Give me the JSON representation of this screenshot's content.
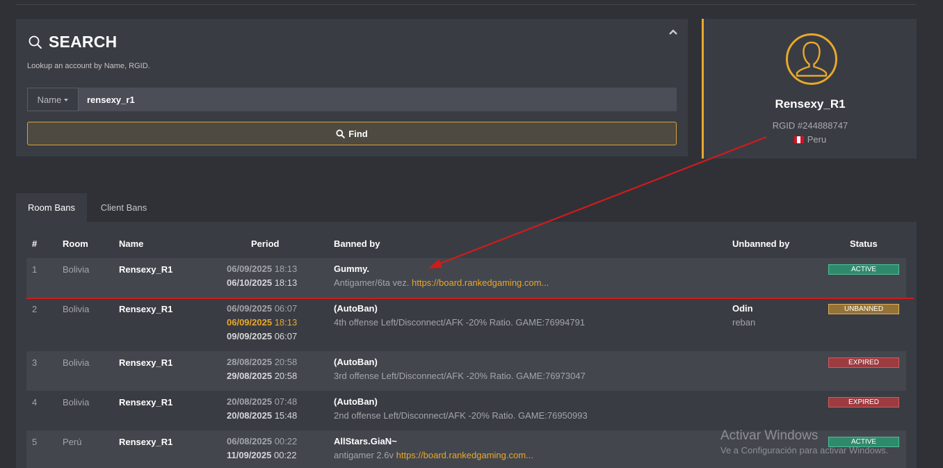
{
  "search": {
    "title": "SEARCH",
    "subtitle": "Lookup an account by Name, RGID.",
    "select_value": "Name",
    "input_value": "rensexy_r1",
    "find_label": "Find"
  },
  "profile": {
    "name": "Rensexy_R1",
    "rgid": "RGID #244888747",
    "country": "Peru"
  },
  "tabs": [
    "Room Bans",
    "Client Bans"
  ],
  "table": {
    "headers": [
      "#",
      "Room",
      "Name",
      "Period",
      "Banned by",
      "Unbanned by",
      "Status"
    ],
    "rows": [
      {
        "num": "1",
        "room": "Bolivia",
        "name": "Rensexy_R1",
        "p1_date": "06/09/2025",
        "p1_time": "18:13",
        "p2_date": "06/10/2025",
        "p2_time": "18:13",
        "banned_by": "Gummy.",
        "reason": "Antigamer/6ta vez.",
        "link": "https://board.rankedgaming.com...",
        "status": "ACTIVE"
      },
      {
        "num": "2",
        "room": "Bolivia",
        "name": "Rensexy_R1",
        "p1_date": "06/09/2025",
        "p1_time": "06:07",
        "p2_date": "06/09/2025",
        "p2_time": "18:13",
        "p3_date": "09/09/2025",
        "p3_time": "06:07",
        "banned_by": "(AutoBan)",
        "reason": "4th offense Left/Disconnect/AFK -20% Ratio. GAME:76994791",
        "unbanned_by": "Odin",
        "unban_reason": "reban",
        "status": "UNBANNED"
      },
      {
        "num": "3",
        "room": "Bolivia",
        "name": "Rensexy_R1",
        "p1_date": "28/08/2025",
        "p1_time": "20:58",
        "p2_date": "29/08/2025",
        "p2_time": "20:58",
        "banned_by": "(AutoBan)",
        "reason": "3rd offense Left/Disconnect/AFK -20% Ratio. GAME:76973047",
        "status": "EXPIRED"
      },
      {
        "num": "4",
        "room": "Bolivia",
        "name": "Rensexy_R1",
        "p1_date": "20/08/2025",
        "p1_time": "07:48",
        "p2_date": "20/08/2025",
        "p2_time": "15:48",
        "banned_by": "(AutoBan)",
        "reason": "2nd offense Left/Disconnect/AFK -20% Ratio. GAME:76950993",
        "status": "EXPIRED"
      },
      {
        "num": "5",
        "room": "Perú",
        "name": "Rensexy_R1",
        "p1_date": "06/08/2025",
        "p1_time": "00:22",
        "p2_date": "11/09/2025",
        "p2_time": "00:22",
        "banned_by": "AllStars.GiaN~",
        "reason": "antigamer 2.6v",
        "link": "https://board.rankedgaming.com...",
        "status": "ACTIVE"
      }
    ]
  },
  "watermark": {
    "line1": "Activar Windows",
    "line2": "Ve a Configuración para activar Windows."
  },
  "colors": {
    "accent": "#e9a82b",
    "active": "#2f8a6c",
    "unbanned": "#947338",
    "expired": "#9c3b40",
    "annotation_red": "#d11b1b"
  },
  "icons": [
    "search-icon",
    "chevron-up-icon",
    "user-avatar-icon",
    "peru-flag-icon",
    "caret-down-icon"
  ]
}
